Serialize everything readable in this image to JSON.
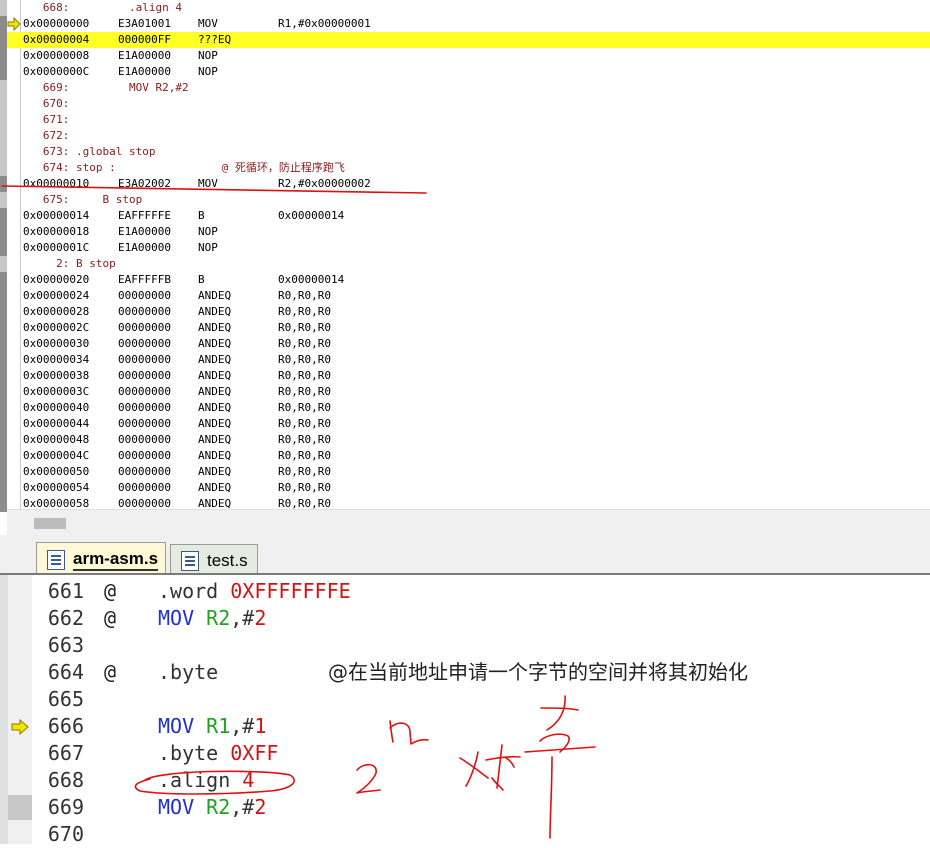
{
  "disassembly": {
    "lines": [
      {
        "type": "src",
        "text": "   668:         .align 4"
      },
      {
        "type": "asm",
        "addr": "0x00000000",
        "op": "E3A01001",
        "mn": "MOV",
        "arg": "R1,#0x00000001",
        "arrow": true
      },
      {
        "type": "asm",
        "addr": "0x00000004",
        "op": "000000FF",
        "mn": "???EQ",
        "arg": "",
        "current": true
      },
      {
        "type": "asm",
        "addr": "0x00000008",
        "op": "E1A00000",
        "mn": "NOP",
        "arg": ""
      },
      {
        "type": "asm",
        "addr": "0x0000000C",
        "op": "E1A00000",
        "mn": "NOP",
        "arg": ""
      },
      {
        "type": "src",
        "text": "   669:         MOV R2,#2"
      },
      {
        "type": "src",
        "text": "   670:"
      },
      {
        "type": "src",
        "text": "   671:"
      },
      {
        "type": "src",
        "text": "   672:"
      },
      {
        "type": "src",
        "text": "   673: .global stop"
      },
      {
        "type": "src",
        "text": "   674: stop :                @ 死循环，防止程序跑飞"
      },
      {
        "type": "asm",
        "addr": "0x00000010",
        "op": "E3A02002",
        "mn": "MOV",
        "arg": "R2,#0x00000002"
      },
      {
        "type": "src",
        "text": "   675:     B stop"
      },
      {
        "type": "asm",
        "addr": "0x00000014",
        "op": "EAFFFFFE",
        "mn": "B",
        "arg": "0x00000014"
      },
      {
        "type": "asm",
        "addr": "0x00000018",
        "op": "E1A00000",
        "mn": "NOP",
        "arg": ""
      },
      {
        "type": "asm",
        "addr": "0x0000001C",
        "op": "E1A00000",
        "mn": "NOP",
        "arg": ""
      },
      {
        "type": "src",
        "text": "     2: B stop"
      },
      {
        "type": "asm",
        "addr": "0x00000020",
        "op": "EAFFFFFB",
        "mn": "B",
        "arg": "0x00000014"
      },
      {
        "type": "asm",
        "addr": "0x00000024",
        "op": "00000000",
        "mn": "ANDEQ",
        "arg": "R0,R0,R0"
      },
      {
        "type": "asm",
        "addr": "0x00000028",
        "op": "00000000",
        "mn": "ANDEQ",
        "arg": "R0,R0,R0"
      },
      {
        "type": "asm",
        "addr": "0x0000002C",
        "op": "00000000",
        "mn": "ANDEQ",
        "arg": "R0,R0,R0"
      },
      {
        "type": "asm",
        "addr": "0x00000030",
        "op": "00000000",
        "mn": "ANDEQ",
        "arg": "R0,R0,R0"
      },
      {
        "type": "asm",
        "addr": "0x00000034",
        "op": "00000000",
        "mn": "ANDEQ",
        "arg": "R0,R0,R0"
      },
      {
        "type": "asm",
        "addr": "0x00000038",
        "op": "00000000",
        "mn": "ANDEQ",
        "arg": "R0,R0,R0"
      },
      {
        "type": "asm",
        "addr": "0x0000003C",
        "op": "00000000",
        "mn": "ANDEQ",
        "arg": "R0,R0,R0"
      },
      {
        "type": "asm",
        "addr": "0x00000040",
        "op": "00000000",
        "mn": "ANDEQ",
        "arg": "R0,R0,R0"
      },
      {
        "type": "asm",
        "addr": "0x00000044",
        "op": "00000000",
        "mn": "ANDEQ",
        "arg": "R0,R0,R0"
      },
      {
        "type": "asm",
        "addr": "0x00000048",
        "op": "00000000",
        "mn": "ANDEQ",
        "arg": "R0,R0,R0"
      },
      {
        "type": "asm",
        "addr": "0x0000004C",
        "op": "00000000",
        "mn": "ANDEQ",
        "arg": "R0,R0,R0"
      },
      {
        "type": "asm",
        "addr": "0x00000050",
        "op": "00000000",
        "mn": "ANDEQ",
        "arg": "R0,R0,R0"
      },
      {
        "type": "asm",
        "addr": "0x00000054",
        "op": "00000000",
        "mn": "ANDEQ",
        "arg": "R0,R0,R0"
      },
      {
        "type": "asm",
        "addr": "0x00000058",
        "op": "00000000",
        "mn": "ANDEQ",
        "arg": "R0,R0,R0"
      }
    ]
  },
  "tabs": [
    {
      "label": "arm-asm.s",
      "active": true
    },
    {
      "label": "test.s",
      "active": false
    }
  ],
  "editor": {
    "lines": [
      {
        "num": "661",
        "at": "@",
        "parts": [
          {
            "t": ".word ",
            "c": "dark"
          },
          {
            "t": "0XFFFFFFFE",
            "c": "red"
          }
        ]
      },
      {
        "num": "662",
        "at": "@",
        "parts": [
          {
            "t": "MOV ",
            "c": "blue"
          },
          {
            "t": "R2",
            "c": "green"
          },
          {
            "t": ",#",
            "c": "dark"
          },
          {
            "t": "2",
            "c": "red"
          }
        ]
      },
      {
        "num": "663",
        "at": "",
        "parts": []
      },
      {
        "num": "664",
        "at": "@",
        "parts": [
          {
            "t": ".byte",
            "c": "dark"
          }
        ],
        "comment": "@在当前地址申请一个字节的空间并将其初始化"
      },
      {
        "num": "665",
        "at": "",
        "parts": []
      },
      {
        "num": "666",
        "at": "",
        "parts": [
          {
            "t": "MOV ",
            "c": "blue"
          },
          {
            "t": "R1",
            "c": "green"
          },
          {
            "t": ",#",
            "c": "dark"
          },
          {
            "t": "1",
            "c": "red"
          }
        ],
        "arrow": true
      },
      {
        "num": "667",
        "at": "",
        "parts": [
          {
            "t": ".byte ",
            "c": "dark"
          },
          {
            "t": "0XFF",
            "c": "red"
          }
        ]
      },
      {
        "num": "668",
        "at": "",
        "parts": [
          {
            "t": ".align ",
            "c": "dark"
          },
          {
            "t": "4",
            "c": "red"
          }
        ]
      },
      {
        "num": "669",
        "at": "",
        "parts": [
          {
            "t": "MOV ",
            "c": "blue"
          },
          {
            "t": "R2",
            "c": "green"
          },
          {
            "t": ",#",
            "c": "dark"
          },
          {
            "t": "2",
            "c": "red"
          }
        ],
        "breakpoint": true
      },
      {
        "num": "670",
        "at": "",
        "parts": []
      }
    ]
  },
  "colors": {
    "highlight": "#ffff26",
    "ink": "#e01010",
    "arrow": "#f2e600"
  }
}
